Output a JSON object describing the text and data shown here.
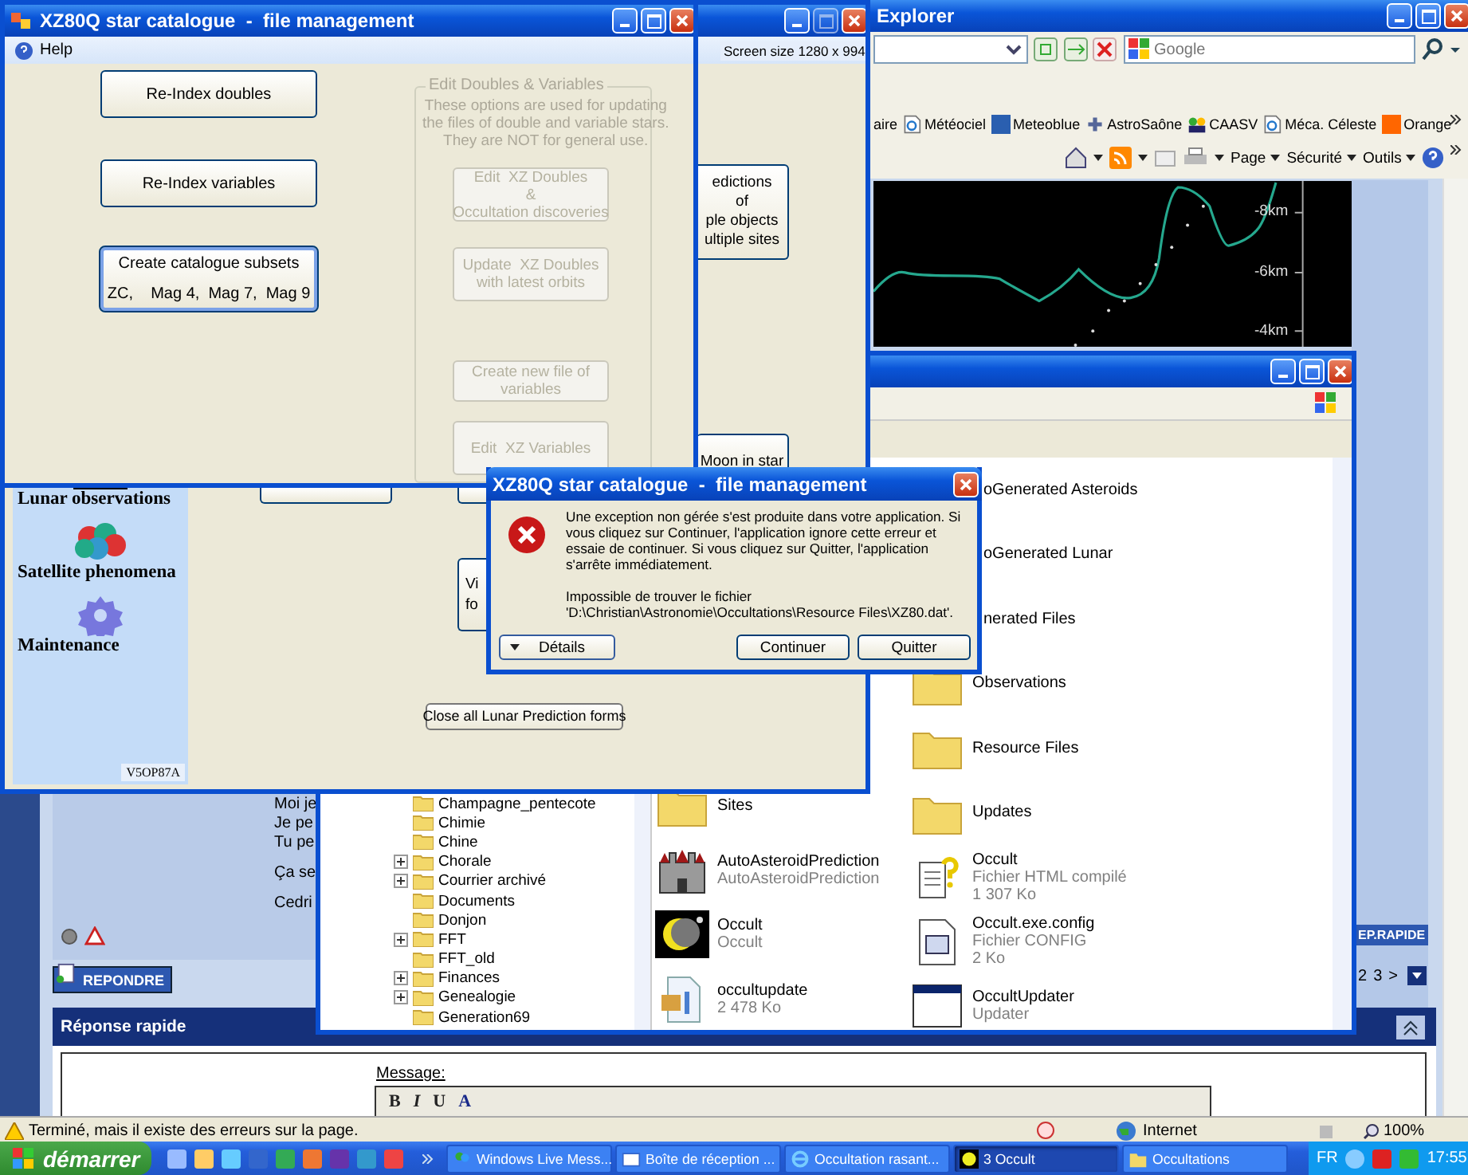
{
  "browser": {
    "title": "Explorer",
    "search_placeholder": "Google",
    "links": [
      "aire",
      "Météociel",
      "Meteoblue",
      "AstroSaône",
      "CAASV",
      "Méca. Céleste",
      "Orange"
    ],
    "commands": [
      "Page",
      "Sécurité",
      "Outils"
    ],
    "chart_axis_labels": [
      "-8km",
      "-6km",
      "-4km"
    ],
    "post_lines": [
      "Moi je",
      "Je pe",
      "Tu pe",
      "Ça se",
      "Cedri"
    ],
    "reply_button": "REPONDRE",
    "quick_reply_button": "EP.RAPIDE",
    "pages": [
      "2",
      "3",
      ">"
    ],
    "quick_reply_title": "Réponse rapide",
    "message_label": "Message:",
    "format_buttons": [
      "B",
      "I",
      "U",
      "A"
    ],
    "status_text": "Terminé, mais il existe des erreurs sur la page.",
    "zone": "Internet",
    "zoom": "100%"
  },
  "occult": {
    "screen_size": "Screen size 1280 x 994",
    "predictions_button": [
      "edictions",
      "of",
      "ple objects",
      "ultiple sites"
    ],
    "moon_button": "Moon in star",
    "view_button": [
      "Vi",
      "fo"
    ],
    "close_forms_button": "Close all Lunar Prediction forms",
    "sidebar": [
      {
        "kind": "chart",
        "label": "Lunar observations"
      },
      {
        "kind": "atoms",
        "label": "Satellite phenomena"
      },
      {
        "kind": "gear",
        "label": "Maintenance"
      }
    ],
    "version": "V5OP87A"
  },
  "xz80q": {
    "title": "XZ80Q star catalogue  -  file management",
    "menu": [
      "Help"
    ],
    "buttons": [
      {
        "lines": [
          "Re-Index doubles"
        ],
        "focused": false
      },
      {
        "lines": [
          "Re-Index variables"
        ],
        "focused": false
      },
      {
        "lines": [
          "Create catalogue subsets",
          "ZC,    Mag 4,  Mag 7,  Mag 9"
        ],
        "focused": true
      }
    ],
    "group": {
      "title": "Edit Doubles & Variables",
      "disabled": true,
      "note_lines": [
        "These options are used for updating",
        "the files of double and variable stars.",
        "They are NOT for general use."
      ],
      "buttons": [
        [
          "Edit  XZ Doubles",
          "&",
          "Occultation discoveries"
        ],
        [
          "Update  XZ Doubles",
          "with latest orbits"
        ],
        [
          "Create new file of",
          "variables"
        ],
        [
          "Edit  XZ Variables"
        ]
      ]
    }
  },
  "error_dialog": {
    "title": "XZ80Q star catalogue  -  file management",
    "message": "Une exception non gérée s'est produite dans votre application. Si vous cliquez sur Continuer, l'application ignore cette erreur et essaie de continuer. Si vous cliquez sur Quitter, l'application s'arrête immédiatement.",
    "detail_lines": [
      "Impossible de trouver le fichier",
      "'D:\\Christian\\Astronomie\\Occultations\\Resource Files\\XZ80.dat'."
    ],
    "details_button": "Détails",
    "buttons": [
      "Continuer",
      "Quitter"
    ]
  },
  "explorer": {
    "tree": [
      {
        "label": "Champagne_pentecote",
        "expandable": false
      },
      {
        "label": "Chimie",
        "expandable": false
      },
      {
        "label": "Chine",
        "expandable": false
      },
      {
        "label": "Chorale",
        "expandable": true
      },
      {
        "label": "Courrier archivé",
        "expandable": true
      },
      {
        "label": "Documents",
        "expandable": false
      },
      {
        "label": "Donjon",
        "expandable": false
      },
      {
        "label": "FFT",
        "expandable": true
      },
      {
        "label": "FFT_old",
        "expandable": false
      },
      {
        "label": "Finances",
        "expandable": true
      },
      {
        "label": "Genealogie",
        "expandable": true
      },
      {
        "label": "Generation69",
        "expandable": false
      }
    ],
    "files_left": [
      {
        "kind": "folder",
        "name": "Sites"
      },
      {
        "kind": "castle",
        "name": "AutoAsteroidPrediction",
        "details": [
          "AutoAsteroidPrediction"
        ]
      },
      {
        "kind": "moon",
        "name": "Occult",
        "details": [
          "Occult"
        ]
      },
      {
        "kind": "installer",
        "name": "occultupdate",
        "details": [
          "2 478 Ko"
        ]
      }
    ],
    "files_right": [
      {
        "name": "oGenerated Asteroids"
      },
      {
        "name": "oGenerated Lunar"
      },
      {
        "name": "nerated Files"
      },
      {
        "kind": "folder",
        "name": "Observations"
      },
      {
        "kind": "folder",
        "name": "Resource Files"
      },
      {
        "kind": "folder",
        "name": "Updates"
      },
      {
        "kind": "help",
        "name": "Occult",
        "details": [
          "Fichier HTML compilé",
          "1 307 Ko"
        ]
      },
      {
        "kind": "config",
        "name": "Occult.exe.config",
        "details": [
          "Fichier CONFIG",
          "2 Ko"
        ]
      },
      {
        "kind": "window",
        "name": "OccultUpdater",
        "details": [
          "Updater"
        ]
      }
    ]
  },
  "taskbar": {
    "start": "démarrer",
    "tasks": [
      {
        "kind": "messenger",
        "label": "Windows Live Mess...",
        "selected": false
      },
      {
        "kind": "mail",
        "label": "Boîte de réception ...",
        "selected": false
      },
      {
        "kind": "ie",
        "label": "Occultation rasant...",
        "selected": false
      },
      {
        "kind": "moon",
        "label": "3 Occult",
        "selected": true
      },
      {
        "kind": "folder",
        "label": "Occultations",
        "selected": false
      }
    ],
    "language": "FR",
    "clock": "17:55"
  }
}
